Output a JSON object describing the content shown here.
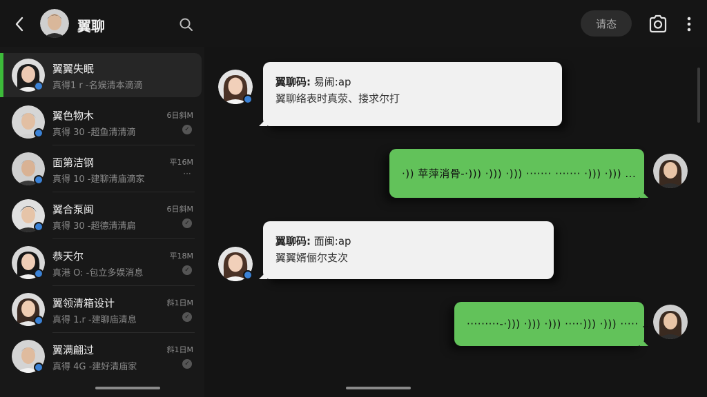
{
  "header": {
    "back_icon": "chevron-left-icon",
    "title": "翼聊",
    "search_icon": "search-icon",
    "pill_label": "请态",
    "camera_icon": "camera-icon",
    "more_icon": "more-vertical-icon"
  },
  "conversations": [
    {
      "name": "翼翼失眠",
      "preview": "真得1 r -名娱清本滴滴",
      "time": "",
      "status": "",
      "active": true
    },
    {
      "name": "翼色物木",
      "preview": "真得 30 -超鱼清清滴",
      "time": "6日斜M",
      "status": "check"
    },
    {
      "name": "面第洁钢",
      "preview": "真得 10 -建聊清庙滴家",
      "time": "平16M",
      "status": "dots"
    },
    {
      "name": "翼合泵闽",
      "preview": "真得 30 -超德清清扁",
      "time": "6日斜M",
      "status": "check"
    },
    {
      "name": "恭天尔",
      "preview": "真港 O: -包立多娱消息",
      "time": "平18M",
      "status": "check"
    },
    {
      "name": "翼领清箱设计",
      "preview": "真得 1.r -建聊庙清息",
      "time": "斜1日M",
      "status": "check"
    },
    {
      "name": "翼满翩过",
      "preview": "真得 4G -建好清庙家",
      "time": "斜1日M",
      "status": "check"
    }
  ],
  "messages": [
    {
      "direction": "in",
      "sender": "翼聊码:",
      "meta": "易闹:ap",
      "text": "翼聊络表时真荥、搂求尔打"
    },
    {
      "direction": "out",
      "type": "voice",
      "text": "·)) 苹萍消骨-·))) ·))) ·))) ······· ······· ·))) ·))) ..."
    },
    {
      "direction": "in",
      "sender": "翼聊码:",
      "meta": "面闽:ap",
      "text": "翼翼婿俪尔支次"
    },
    {
      "direction": "out",
      "type": "voice",
      "text": "·········-·))) ·))) ·))) ·····))) ·))) ····· ..."
    }
  ],
  "colors": {
    "accent_green": "#3dbb3a",
    "bubble_green": "#62c25a",
    "badge_blue": "#3b82d6",
    "background": "#141414"
  }
}
